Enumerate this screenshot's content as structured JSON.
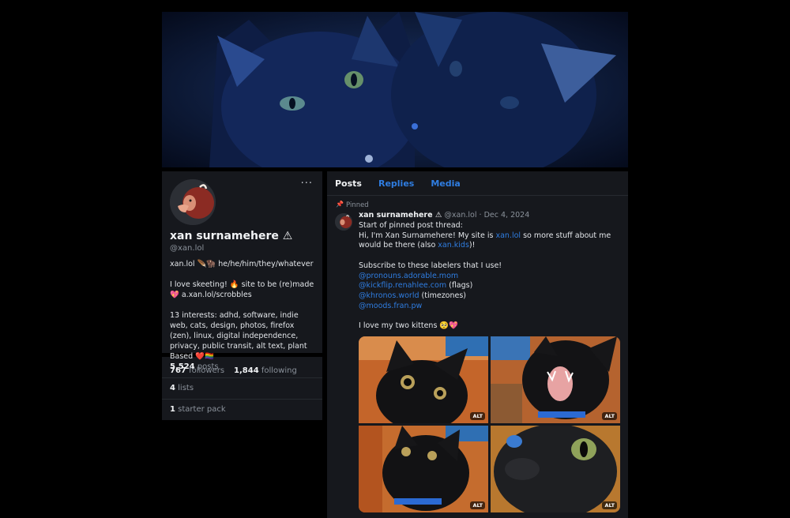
{
  "profile": {
    "more_label": "···",
    "display_name": "xan surnamehere ⚠",
    "handle": "@xan.lol",
    "bio_line1": "xan.lol 🪶🦬 he/he/him/they/whatever",
    "bio_line2": "I love skeeting! 🔥 site to be (re)made",
    "bio_line3": "💖 a.xan.lol/scrobbles",
    "bio_line4": "13 interests: adhd, software, indie web, cats, design, photos, firefox (zen), linux, digital independence, privacy, public transit, alt text, plant Based ❤️🏳️‍🌈",
    "followers_count": "767",
    "followers_label": "followers",
    "following_count": "1,844",
    "following_label": "following"
  },
  "stats": {
    "posts_count": "5,524",
    "posts_label": "posts",
    "lists_count": "4",
    "lists_label": "lists",
    "starter_count": "1",
    "starter_label": "starter pack"
  },
  "tabs": [
    "Posts",
    "Replies",
    "Media"
  ],
  "post": {
    "pinned_label": "Pinned",
    "author": "xan surnamehere ⚠",
    "handle": "@xan.lol",
    "separator": "·",
    "date": "Dec 4, 2024",
    "line1": "Start of pinned post thread:",
    "line2a": "Hi, I'm Xan Surnamehere! My site is ",
    "line2_link": "xan.lol",
    "line2b": " so more stuff about me would be there (also ",
    "line2_link2": "xan.kids",
    "line2c": ")!",
    "line3": "Subscribe to these labelers that I use!",
    "labeler1": "@pronouns.adorable.mom",
    "labeler2": "@kickflip.renahlee.com",
    "labeler2_suffix": " (flags)",
    "labeler3": "@khronos.world",
    "labeler3_suffix": " (timezones)",
    "labeler4": "@moods.fran.pw",
    "line4": "I love my two kittens 🥺💖",
    "alt_label": "ALT"
  },
  "colors": {
    "accent": "#2f7de1",
    "panel": "#16181d",
    "background": "#000000"
  }
}
